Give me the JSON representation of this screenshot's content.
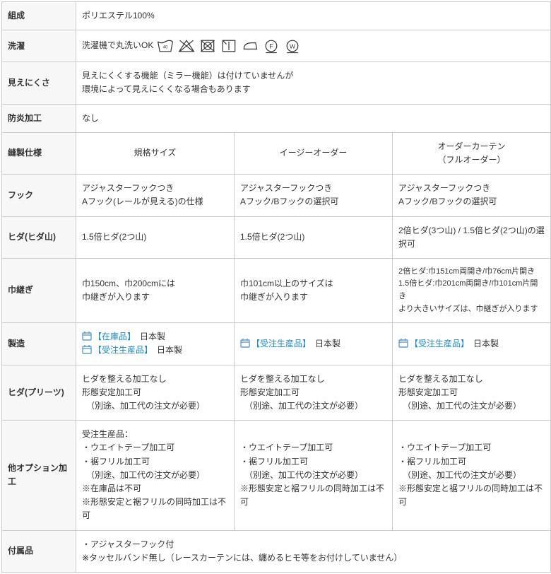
{
  "rows": {
    "composition": {
      "label": "組成",
      "value": "ポリエステル100%"
    },
    "wash": {
      "label": "洗濯",
      "prefix": "洗濯機で丸洗いOK"
    },
    "opacity": {
      "label": "見えにくさ",
      "line1": "見えにくくする機能（ミラー機能）は付けていませんが",
      "line2": "環境によって見えにくくなる場合もあります"
    },
    "fireproof": {
      "label": "防炎加工",
      "value": "なし"
    },
    "spec": {
      "label": "縫製仕様",
      "col1": "規格サイズ",
      "col2": "イージーオーダー",
      "col3_line1": "オーダーカーテン",
      "col3_line2": "（フルオーダー）"
    },
    "hook": {
      "label": "フック",
      "c1l1": "アジャスターフックつき",
      "c1l2": "Aフック(レールが見える)の仕様",
      "c2l1": "アジャスターフックつき",
      "c2l2": "Aフック/Bフックの選択可",
      "c3l1": "アジャスターフックつき",
      "c3l2": "Aフック/Bフックの選択可"
    },
    "pleat_mt": {
      "label": "ヒダ(ヒダ山)",
      "c1": "1.5倍ヒダ(2つ山)",
      "c2": "1.5倍ヒダ(2つ山)",
      "c3": "2倍ヒダ(3つ山) / 1.5倍ヒダ(2つ山)の選択可"
    },
    "seam": {
      "label": "巾継ぎ",
      "c1l1": "巾150cm、巾200cmには",
      "c1l2": "巾継ぎが入ります",
      "c2l1": "巾101cm以上のサイズは",
      "c2l2": "巾継ぎが入ります",
      "c3l1": "2倍ヒダ:巾151cm両開き/巾76cm片開き",
      "c3l2": "1.5倍ヒダ:巾201cm両開き/巾101cm片開き",
      "c3l3": "より大きいサイズは、巾継ぎが入ります"
    },
    "manufacture": {
      "label": "製造",
      "stock": "【在庫品】",
      "made_jp": "日本製",
      "order": "【受注生産品】"
    },
    "pleat_proc": {
      "label": "ヒダ(プリーツ)",
      "l1": "ヒダを整える加工なし",
      "l2": "形態安定加工可",
      "l3": "　（別途、加工代の注文が必要）"
    },
    "options": {
      "label": "他オプション加工",
      "c1l1": "受注生産品：",
      "c1l2": "・ウエイトテープ加工可",
      "c1l3": "・裾フリル加工可",
      "c1l4": "　（別途、加工代の注文が必要）",
      "c1l5": "※在庫品は不可",
      "c1l6": "※形態安定と裾フリルの同時加工は不可",
      "c2l1": "・ウエイトテープ加工可",
      "c2l2": "・裾フリル加工可",
      "c2l3": "　（別途、加工代の注文が必要）",
      "c2l4": "※形態安定と裾フリルの同時加工は不可",
      "c3l1": "・ウエイトテープ加工可",
      "c3l2": "・裾フリル加工可",
      "c3l3": "　（別途、加工代の注文が必要）",
      "c3l4": "※形態安定と裾フリルの同時加工は不可"
    },
    "accessory": {
      "label": "付属品",
      "l1": "・アジャスターフック付",
      "l2": "※タッセルバンド無し（レースカーテンには、纏めるヒモ等をお付けしていません）"
    }
  }
}
